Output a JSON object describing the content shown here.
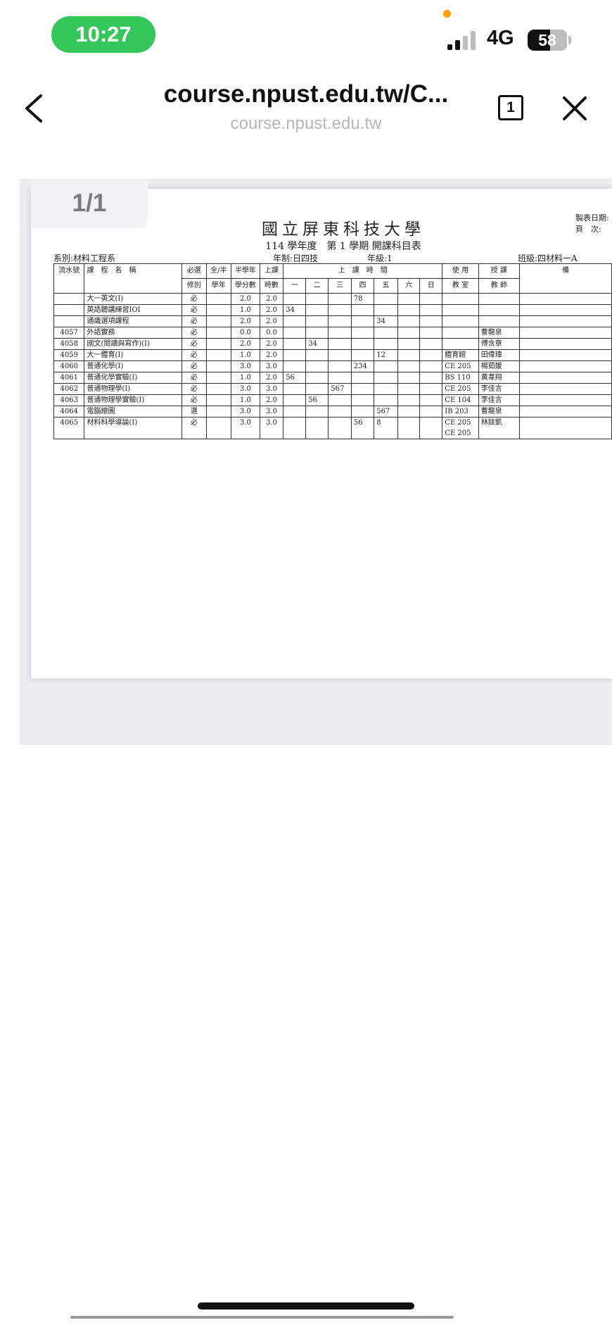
{
  "status_bar": {
    "time": "10:27",
    "network": "4G",
    "battery": "58"
  },
  "browser": {
    "url_title": "course.npust.edu.tw/C...",
    "url_domain": "course.npust.edu.tw",
    "tab_count": "1"
  },
  "viewer": {
    "page_indicator": "1/1"
  },
  "document": {
    "title": "國立屏東科技大學",
    "subtitle": "114 學年度　第 1 學期 開課科目表",
    "made_date_label": "製表日期:",
    "page_label": "頁　次:",
    "department": "系別:材料工程系",
    "system": "年制:日四技",
    "grade": "年級:1",
    "class": "班級:四材料一A",
    "headers": {
      "serial": "流水號",
      "course_name": "課　程　名　稱",
      "req_top": "必選",
      "req_bottom": "修別",
      "full_top": "全/半",
      "full_bottom": "學年",
      "credit_top": "半學年",
      "credit_bottom": "學分數",
      "hours_top": "上課",
      "hours_bottom": "時數",
      "time": "上　課　時　間",
      "days": [
        "一",
        "二",
        "三",
        "四",
        "五",
        "六",
        "日"
      ],
      "room_top": "使 用",
      "room_bottom": "教 室",
      "teacher_top": "授 課",
      "teacher_bottom": "教 師",
      "remark": "備"
    },
    "rows": [
      {
        "serial": "",
        "name": "大一英文(I)",
        "req": "必",
        "full": "",
        "credit": "2.0",
        "hours": "2.0",
        "days": [
          "",
          "",
          "",
          "78",
          "",
          "",
          ""
        ],
        "room": "",
        "teacher": ""
      },
      {
        "serial": "",
        "name": "英語聽講練習IOI",
        "req": "必",
        "full": "",
        "credit": "1.0",
        "hours": "2.0",
        "days": [
          "34",
          "",
          "",
          "",
          "",
          "",
          ""
        ],
        "room": "",
        "teacher": ""
      },
      {
        "serial": "",
        "name": "通識選項課程",
        "req": "必",
        "full": "",
        "credit": "2.0",
        "hours": "2.0",
        "days": [
          "",
          "",
          "",
          "",
          "34",
          "",
          ""
        ],
        "room": "",
        "teacher": ""
      },
      {
        "serial": "4057",
        "name": "外語實務",
        "req": "必",
        "full": "",
        "credit": "0.0",
        "hours": "0.0",
        "days": [
          "",
          "",
          "",
          "",
          "",
          "",
          ""
        ],
        "room": "",
        "teacher": "曹龍泉"
      },
      {
        "serial": "4058",
        "name": "國文(閱讀與寫作)(I)",
        "req": "必",
        "full": "",
        "credit": "2.0",
        "hours": "2.0",
        "days": [
          "",
          "34",
          "",
          "",
          "",
          "",
          ""
        ],
        "room": "",
        "teacher": "傅含章"
      },
      {
        "serial": "4059",
        "name": "大一體育(I)",
        "req": "必",
        "full": "",
        "credit": "1.0",
        "hours": "2.0",
        "days": [
          "",
          "",
          "",
          "",
          "12",
          "",
          ""
        ],
        "room": "體育館",
        "teacher": "田偉瑋"
      },
      {
        "serial": "4060",
        "name": "普通化學(I)",
        "req": "必",
        "full": "",
        "credit": "3.0",
        "hours": "3.0",
        "days": [
          "",
          "",
          "",
          "234",
          "",
          "",
          ""
        ],
        "room": "CE 205",
        "teacher": "楊茹媛"
      },
      {
        "serial": "4061",
        "name": "普通化學實驗(I)",
        "req": "必",
        "full": "",
        "credit": "1.0",
        "hours": "2.0",
        "days": [
          "56",
          "",
          "",
          "",
          "",
          "",
          ""
        ],
        "room": "BS 110",
        "teacher": "黃韋翔"
      },
      {
        "serial": "4062",
        "name": "普通物理學(I)",
        "req": "必",
        "full": "",
        "credit": "3.0",
        "hours": "3.0",
        "days": [
          "",
          "",
          "567",
          "",
          "",
          "",
          ""
        ],
        "room": "CE 205",
        "teacher": "李佳言"
      },
      {
        "serial": "4063",
        "name": "普通物理學實驗(I)",
        "req": "必",
        "full": "",
        "credit": "1.0",
        "hours": "2.0",
        "days": [
          "",
          "56",
          "",
          "",
          "",
          "",
          ""
        ],
        "room": "CE 104",
        "teacher": "李佳言"
      },
      {
        "serial": "4064",
        "name": "電腦繪圖",
        "req": "選",
        "full": "",
        "credit": "3.0",
        "hours": "3.0",
        "days": [
          "",
          "",
          "",
          "",
          "567",
          "",
          ""
        ],
        "room": "IB 203",
        "teacher": "曹龍泉"
      },
      {
        "serial": "4065",
        "name": "材料科學導論(I)",
        "req": "必",
        "full": "",
        "credit": "3.0",
        "hours": "3.0",
        "days": [
          "",
          "",
          "",
          "56",
          "8",
          "",
          ""
        ],
        "room": "CE 205",
        "room2": "CE 205",
        "teacher": "林鉉凱"
      }
    ]
  }
}
